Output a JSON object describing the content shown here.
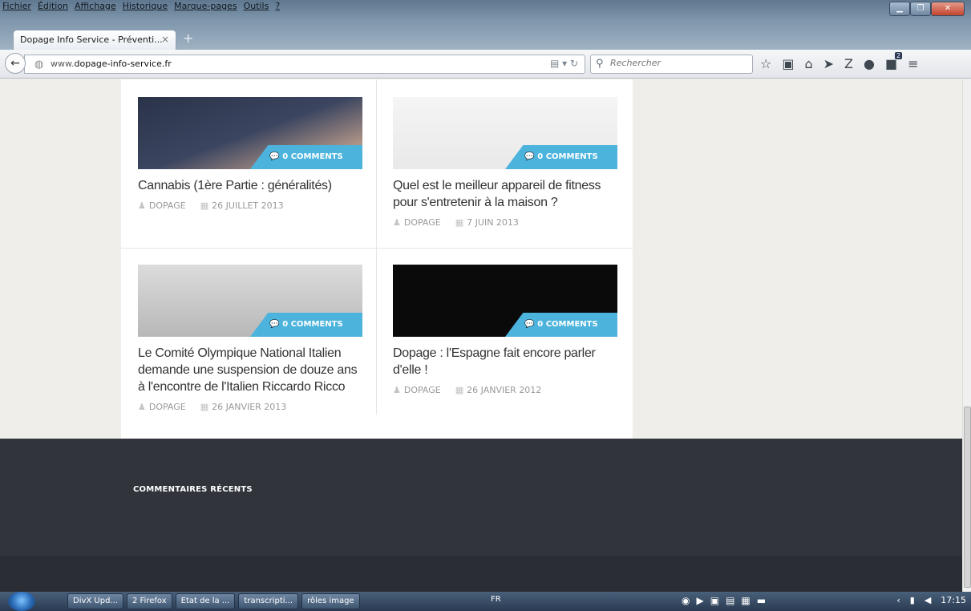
{
  "browser": {
    "menu": [
      "Fichier",
      "Édition",
      "Affichage",
      "Historique",
      "Marque-pages",
      "Outils",
      "?"
    ],
    "tab_title": "Dopage Info Service - Préventi...",
    "url_prefix": "www.",
    "url_domain": "dopage-info-service.fr",
    "search_placeholder": "Rechercher",
    "notification_count": "2"
  },
  "posts": [
    {
      "title": "Cannabis (1ère Partie : généralités)",
      "comments": "0 COMMENTS",
      "author": "DOPAGE",
      "date": "26 JUILLET 2013"
    },
    {
      "title": "Quel est le meilleur appareil de fitness pour s'entretenir à la maison ?",
      "comments": "0 COMMENTS",
      "author": "DOPAGE",
      "date": "7 JUIN 2013"
    },
    {
      "title": "Le Comité Olympique National Italien demande une suspension de douze ans à l'encontre de l'Italien Riccardo Ricco",
      "comments": "0 COMMENTS",
      "author": "DOPAGE",
      "date": "26 JANVIER 2013"
    },
    {
      "title": "Dopage : l'Espagne fait encore parler d'elle !",
      "comments": "0 COMMENTS",
      "author": "DOPAGE",
      "date": "26 JANVIER 2012"
    }
  ],
  "footer": {
    "recent_comments_title": "COMMENTAIRES RÉCENTS"
  },
  "taskbar": {
    "tasks": [
      "DivX Upd...",
      "2 Firefox",
      "Etat de la ...",
      "transcripti...",
      "rôles image"
    ],
    "language": "FR",
    "clock": "17:15"
  },
  "colors": {
    "accent": "#4bb3dc",
    "footer": "#31353b"
  }
}
